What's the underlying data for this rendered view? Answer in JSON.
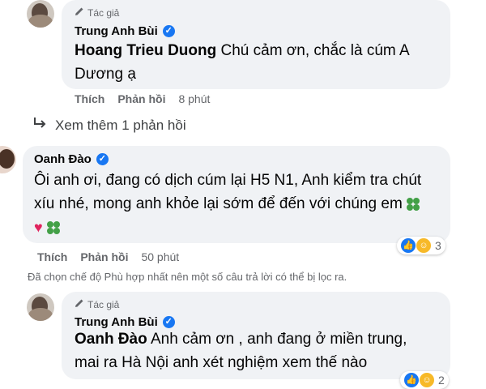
{
  "comment1": {
    "tag": "Tác giả",
    "author": "Trung Anh Bùi",
    "mention": "Hoang Trieu Duong",
    "text_line1": "Chú cảm ơn, chắc là cúm A",
    "text_line2": "Dương ạ",
    "like": "Thích",
    "reply": "Phản hồi",
    "time": "8 phút"
  },
  "view_more": "Xem thêm 1 phản hồi",
  "comment2": {
    "author": "Oanh Đào",
    "line1": "Ôi anh ơi, đang có dịch cúm lại H5 N1, Anh kiểm tra chút",
    "line2": "xíu nhé, mong anh khỏe lại sớm để đến với chúng em",
    "like": "Thích",
    "reply": "Phản hồi",
    "time": "50 phút",
    "reaction_count": "3"
  },
  "notice": "Đã chọn chế độ Phù hợp nhất nên một số câu trả lời có thể bị lọc ra.",
  "comment3": {
    "tag": "Tác giả",
    "author": "Trung Anh Bùi",
    "mention": "Oanh Đào",
    "text_line1": "Anh cảm ơn , anh đang ở miền trung,",
    "text_line2": "mai ra Hà Nội anh xét nghiệm xem thế nào",
    "reaction_count": "2"
  },
  "icons": {
    "pencil": "pencil-icon",
    "verified": "verified-check-icon",
    "reply_arrow": "reply-arrow-icon",
    "like": "like-reaction-icon",
    "care": "care-reaction-icon",
    "clover": "four-leaf-clover-emoji",
    "heart": "red-heart-emoji"
  },
  "colors": {
    "bubble": "#f0f2f5",
    "verified": "#1877f2",
    "meta_text": "#65676b"
  }
}
